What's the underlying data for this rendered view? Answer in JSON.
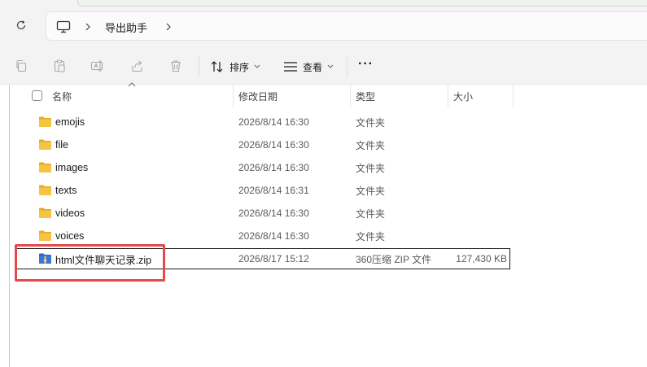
{
  "window": {
    "breadcrumb": [
      {
        "label": "",
        "icon": "computer-icon"
      },
      {
        "label": "导出助手"
      }
    ]
  },
  "toolbar": {
    "sort_label": "排序",
    "view_label": "查看",
    "more_label": "···",
    "disabled_icons": [
      "copy-icon",
      "paste-icon",
      "rename-icon",
      "share-icon",
      "delete-icon"
    ]
  },
  "columns": {
    "name": "名称",
    "date": "修改日期",
    "type": "类型",
    "size": "大小"
  },
  "files": [
    {
      "name": "emojis",
      "date": "2026/8/14 16:30",
      "type": "文件夹",
      "size": "",
      "kind": "folder"
    },
    {
      "name": "file",
      "date": "2026/8/14 16:30",
      "type": "文件夹",
      "size": "",
      "kind": "folder"
    },
    {
      "name": "images",
      "date": "2026/8/14 16:30",
      "type": "文件夹",
      "size": "",
      "kind": "folder"
    },
    {
      "name": "texts",
      "date": "2026/8/14 16:31",
      "type": "文件夹",
      "size": "",
      "kind": "folder"
    },
    {
      "name": "videos",
      "date": "2026/8/14 16:30",
      "type": "文件夹",
      "size": "",
      "kind": "folder"
    },
    {
      "name": "voices",
      "date": "2026/8/14 16:30",
      "type": "文件夹",
      "size": "",
      "kind": "folder"
    },
    {
      "name": "html文件聊天记录.zip",
      "date": "2026/8/17 15:12",
      "type": "360压缩 ZIP 文件",
      "size": "127,430 KB",
      "kind": "zip",
      "selected": true
    }
  ],
  "colors": {
    "folder": "#f6c445",
    "folder_dark": "#e8a91f",
    "highlight": "#e5484d",
    "zip_blue": "#3a78d6"
  }
}
